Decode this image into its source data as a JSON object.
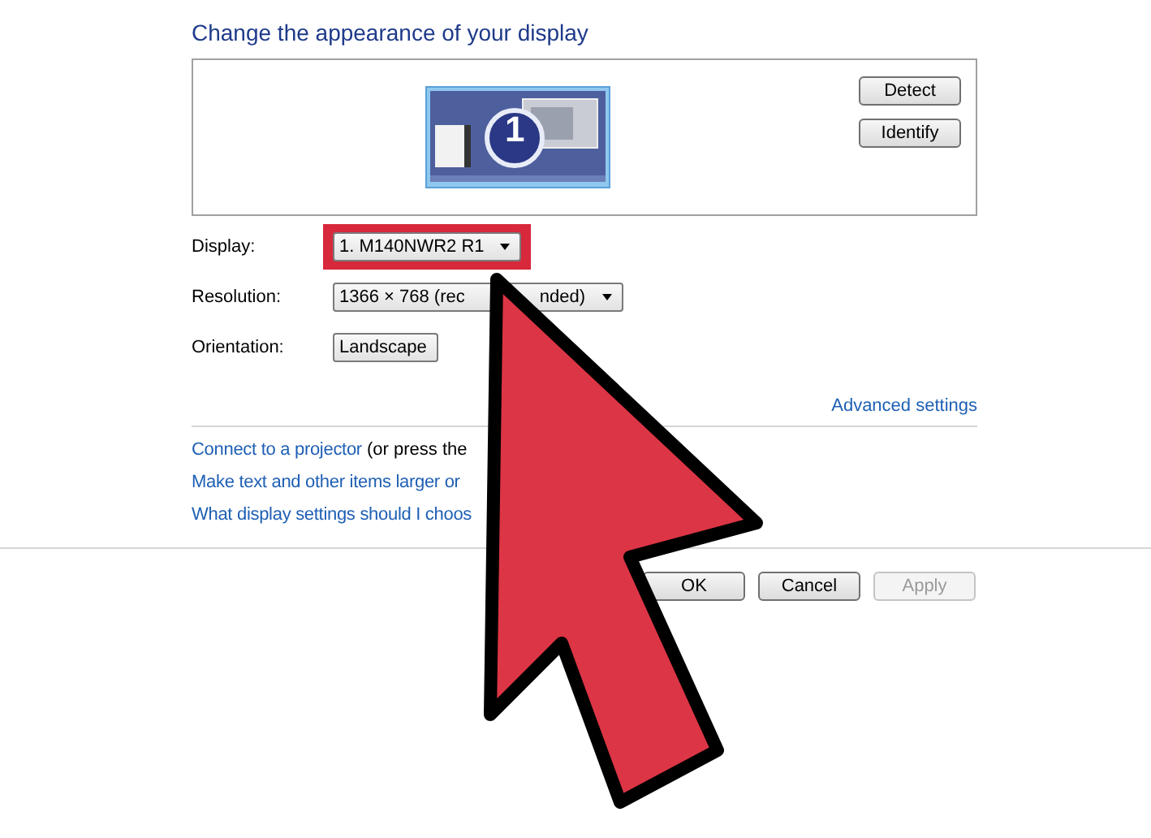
{
  "title": "Change the appearance of your display",
  "preview": {
    "display_number": "1",
    "buttons": [
      {
        "label": "Detect"
      },
      {
        "label": "Identify"
      }
    ]
  },
  "settings": [
    {
      "label": "Display:",
      "value_parts": [
        "1. M140NWR2 R1"
      ],
      "caret": true,
      "highlighted": true
    },
    {
      "label": "Resolution:",
      "value_parts": [
        "1366 × 768 (rec",
        "nded)"
      ],
      "caret": true,
      "highlighted": false
    },
    {
      "label": "Orientation:",
      "value_parts": [
        "Landscape"
      ],
      "caret": false,
      "highlighted": false
    }
  ],
  "advanced_link": "Advanced settings",
  "links": [
    {
      "link": "Connect to a projector",
      "text": " (or press the"
    },
    {
      "link": "Make text and other items larger or"
    },
    {
      "link": "What display settings should I choos"
    }
  ],
  "buttons": [
    {
      "label": "OK",
      "disabled": false
    },
    {
      "label": "Cancel",
      "disabled": false
    },
    {
      "label": "Apply",
      "disabled": true
    }
  ],
  "annotation": {
    "kind": "arrow"
  }
}
